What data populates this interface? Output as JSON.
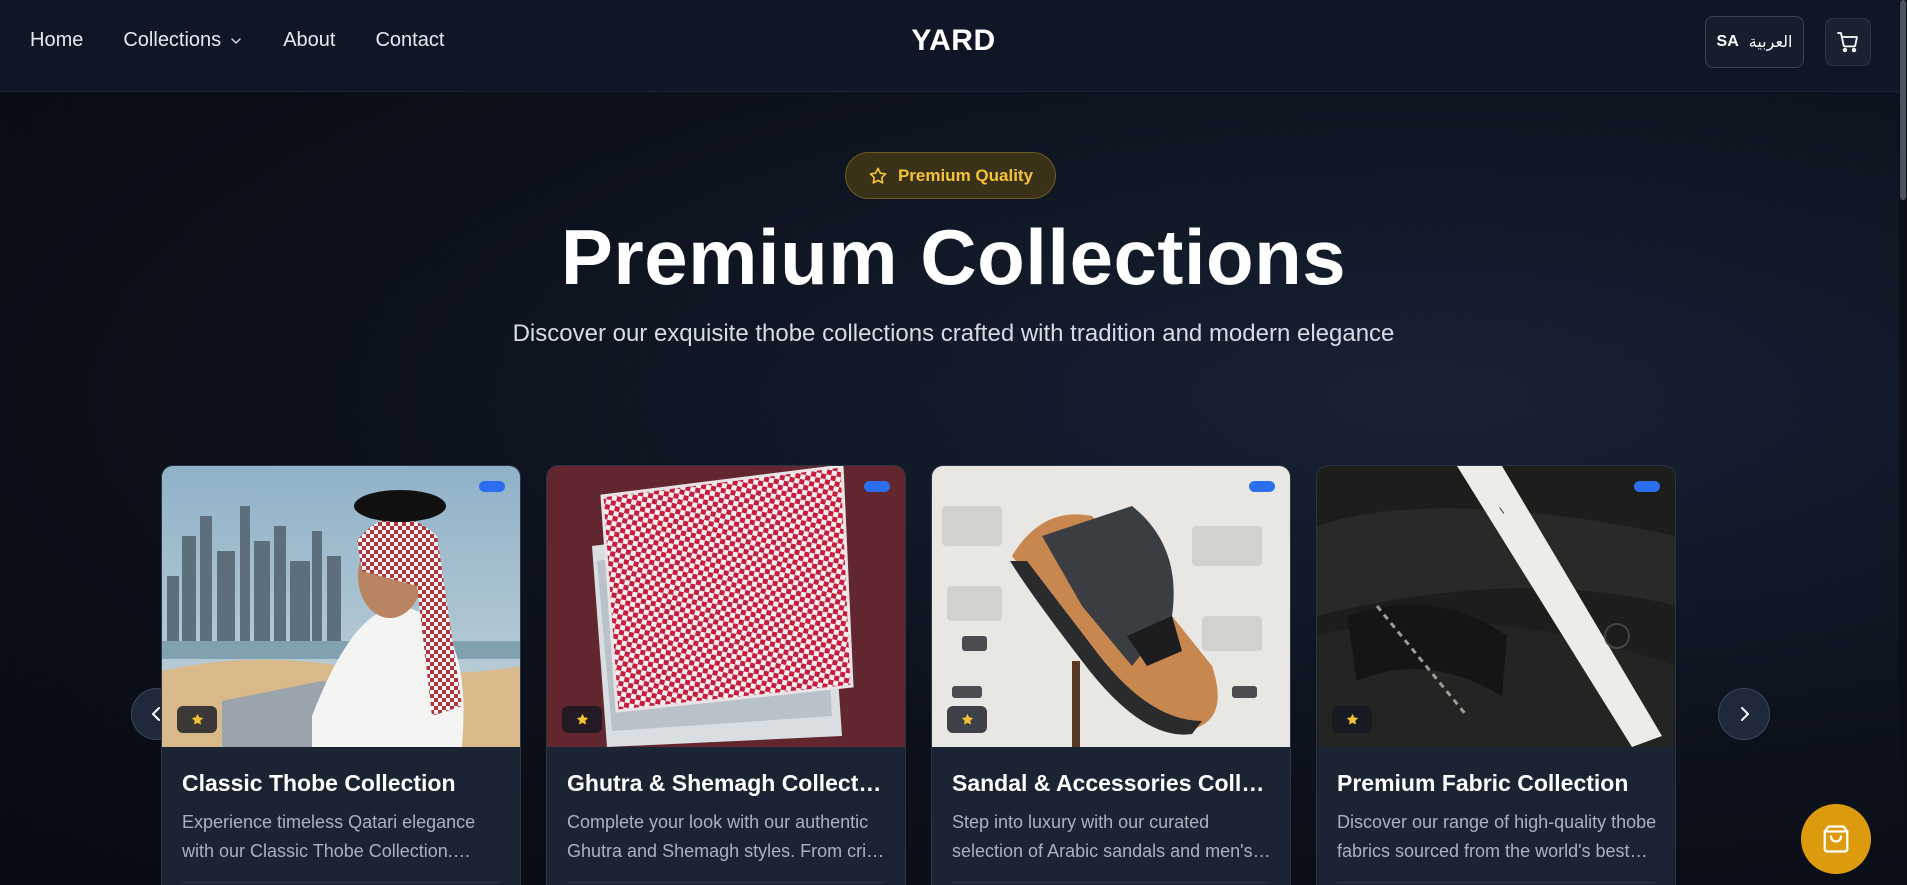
{
  "header": {
    "nav": [
      "Home",
      "Collections",
      "About",
      "Contact"
    ],
    "brand": "YARD",
    "lang_code": "SA",
    "lang_label": "العربية"
  },
  "hero": {
    "badge": "Premium Quality",
    "title": "Premium Collections",
    "subtitle": "Discover our exquisite thobe collections crafted with tradition and modern elegance"
  },
  "cards": [
    {
      "title": "Classic Thobe Collection",
      "desc": "Experience timeless Qatari elegance with our Classic Thobe Collection. Crafted for comfort and style."
    },
    {
      "title": "Ghutra & Shemagh Collection",
      "desc": "Complete your look with our authentic Ghutra and Shemagh styles. From crisp whites to classic reds."
    },
    {
      "title": "Sandal & Accessories Collection",
      "desc": "Step into luxury with our curated selection of Arabic sandals and men's accessories."
    },
    {
      "title": "Premium Fabric Collection",
      "desc": "Discover our range of high-quality thobe fabrics sourced from the world's best mills."
    }
  ],
  "colors": {
    "accent_gold": "#f4c232",
    "badge_blue": "#2b6ff0",
    "fab": "#dc9a0d",
    "background": "#0c111b"
  },
  "icons": {
    "collections_chevron": "chevron-down-icon",
    "badge": "star-outline-icon",
    "cart": "cart-icon",
    "card_badge": "star-icon",
    "prev": "chevron-left-icon",
    "next": "chevron-right-icon",
    "fab": "shopping-bag-icon"
  }
}
